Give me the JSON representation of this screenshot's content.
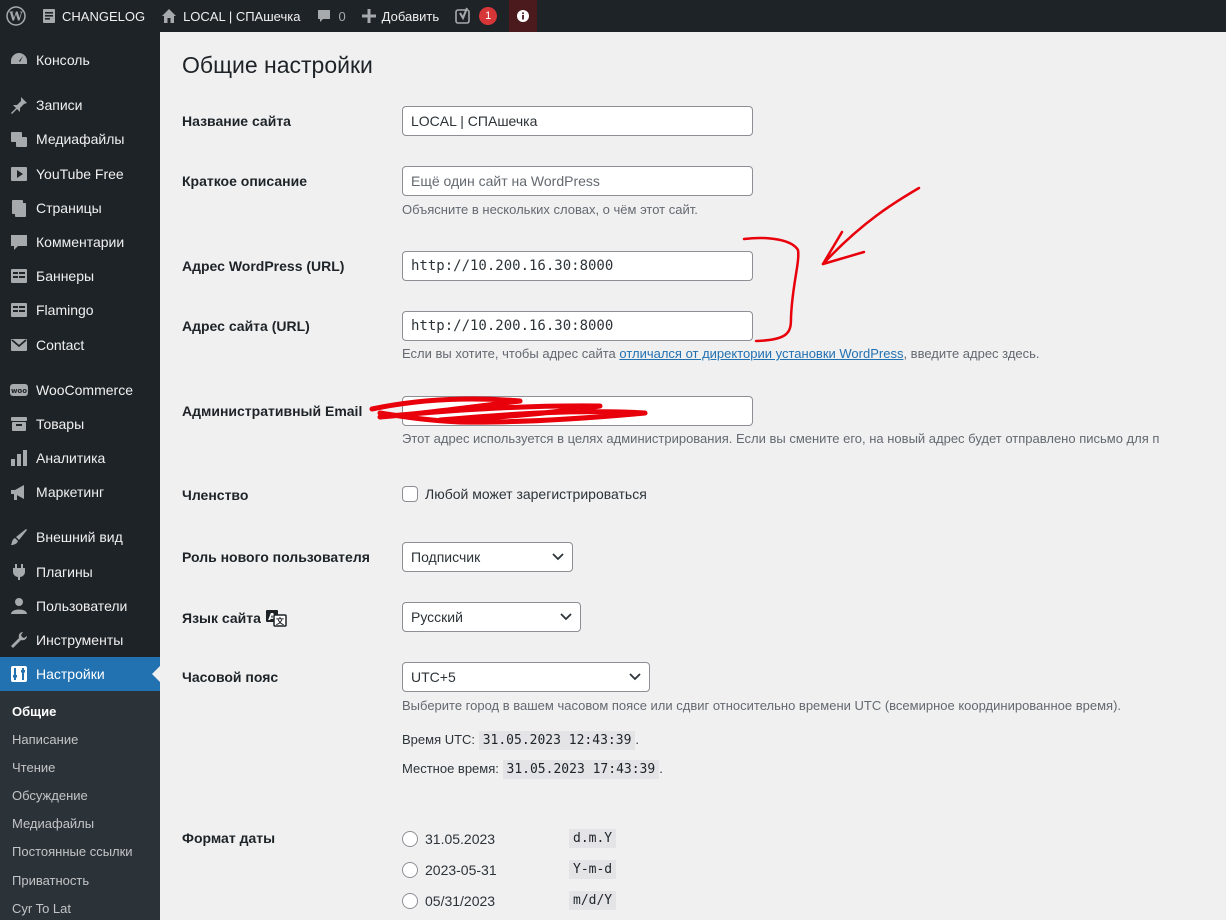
{
  "adminbar": {
    "site_changelog": "CHANGELOG",
    "site_name": "LOCAL | СПАшечка",
    "comments_count": "0",
    "new_label": "Добавить",
    "yoast_badge": "1"
  },
  "sidebar": {
    "items": [
      {
        "label": "Консоль",
        "icon": "dashboard-icon"
      },
      {
        "label": "Записи",
        "icon": "pin-icon"
      },
      {
        "label": "Медиафайлы",
        "icon": "media-icon"
      },
      {
        "label": "YouTube Free",
        "icon": "video-icon"
      },
      {
        "label": "Страницы",
        "icon": "pages-icon"
      },
      {
        "label": "Комментарии",
        "icon": "comment-icon"
      },
      {
        "label": "Баннеры",
        "icon": "table-icon"
      },
      {
        "label": "Flamingo",
        "icon": "table-icon"
      },
      {
        "label": "Contact",
        "icon": "mail-icon"
      },
      {
        "label": "WooCommerce",
        "icon": "woo-icon"
      },
      {
        "label": "Товары",
        "icon": "archive-icon"
      },
      {
        "label": "Аналитика",
        "icon": "chart-icon"
      },
      {
        "label": "Маркетинг",
        "icon": "megaphone-icon"
      },
      {
        "label": "Внешний вид",
        "icon": "brush-icon"
      },
      {
        "label": "Плагины",
        "icon": "plugin-icon"
      },
      {
        "label": "Пользователи",
        "icon": "users-icon"
      },
      {
        "label": "Инструменты",
        "icon": "wrench-icon"
      },
      {
        "label": "Настройки",
        "icon": "settings-icon"
      }
    ],
    "submenu": [
      "Общие",
      "Написание",
      "Чтение",
      "Обсуждение",
      "Медиафайлы",
      "Постоянные ссылки",
      "Приватность",
      "Cyr To Lat"
    ]
  },
  "page": {
    "title": "Общие настройки",
    "site_title_label": "Название сайта",
    "site_title_value": "LOCAL | СПАшечка",
    "tagline_label": "Краткое описание",
    "tagline_placeholder": "Ещё один сайт на WordPress",
    "tagline_desc": "Объясните в нескольких словах, о чём этот сайт.",
    "wp_url_label": "Адрес WordPress (URL)",
    "wp_url_value": "http://10.200.16.30:8000",
    "site_url_label": "Адрес сайта (URL)",
    "site_url_value": "http://10.200.16.30:8000",
    "site_url_desc_before": "Если вы хотите, чтобы адрес сайта ",
    "site_url_desc_link": "отличался от директории установки WordPress",
    "site_url_desc_after": ", введите адрес здесь.",
    "email_label": "Административный Email",
    "email_desc": "Этот адрес используется в целях администрирования. Если вы смените его, на новый адрес будет отправлено письмо для п",
    "membership_label": "Членство",
    "membership_checkbox": "Любой может зарегистрироваться",
    "role_label": "Роль нового пользователя",
    "role_value": "Подписчик",
    "language_label": "Язык сайта",
    "language_value": "Русский",
    "timezone_label": "Часовой пояс",
    "timezone_value": "UTC+5",
    "timezone_desc": "Выберите город в вашем часовом поясе или сдвиг относительно времени UTC (всемирное координированное время).",
    "utc_time_label": "Время UTC:",
    "utc_time_value": "31.05.2023 12:43:39",
    "local_time_label": "Местное время:",
    "local_time_value": "31.05.2023 17:43:39",
    "date_format_label": "Формат даты",
    "date_formats": [
      {
        "example": "31.05.2023",
        "code": "d.m.Y"
      },
      {
        "example": "2023-05-31",
        "code": "Y-m-d"
      },
      {
        "example": "05/31/2023",
        "code": "m/d/Y"
      }
    ]
  },
  "colors": {
    "adminbar_bg": "#1d2327",
    "menu_current": "#2271b1",
    "annotation_red": "#e8000b",
    "link": "#2271b1"
  }
}
